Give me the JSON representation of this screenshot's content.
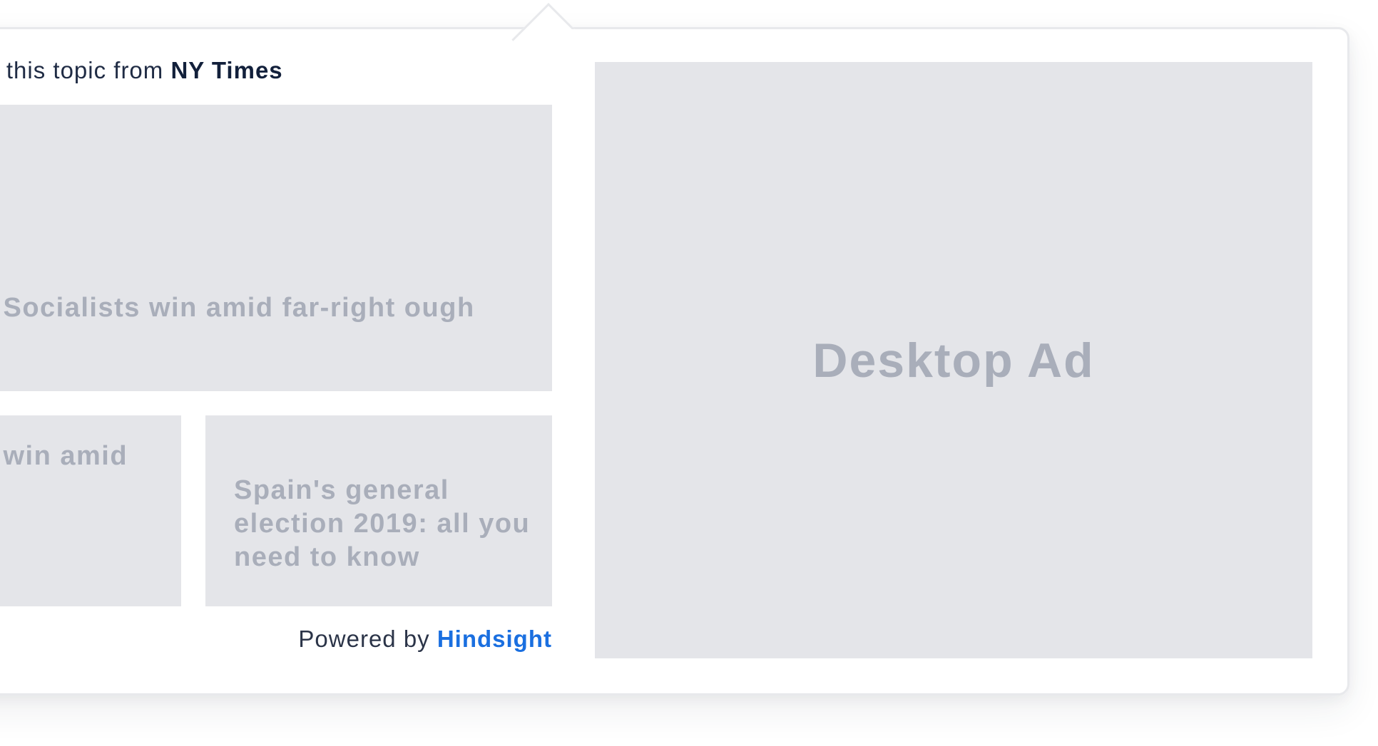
{
  "widget": {
    "heading_prefix": "on this topic from",
    "source_name": "NY Times",
    "articles": [
      {
        "title": "ction: Socialists win amid far-right ough"
      },
      {
        "title": "ction: win amid ough"
      },
      {
        "title": "Spain's general election 2019: all you need to know"
      }
    ],
    "powered_prefix": "Powered by",
    "powered_brand": "Hindsight"
  },
  "ad": {
    "label": "Desktop Ad"
  },
  "colors": {
    "brand_link": "#1a6fe0",
    "placeholder_bg": "#e4e5e9",
    "placeholder_text": "#a9aeba",
    "heading_text": "#1f2b44"
  }
}
